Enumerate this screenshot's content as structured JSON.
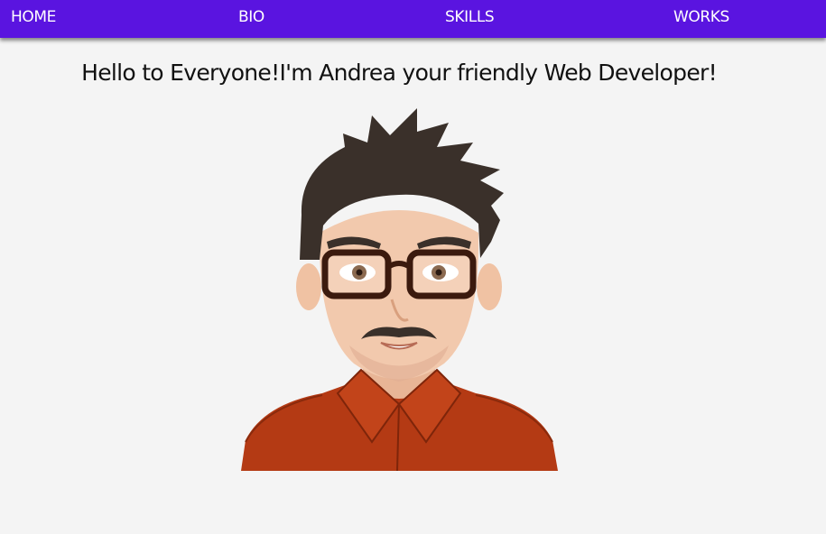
{
  "nav": {
    "items": [
      {
        "id": "home",
        "label": "HOME"
      },
      {
        "id": "bio",
        "label": "BIO"
      },
      {
        "id": "skills",
        "label": "SKILLS"
      },
      {
        "id": "works",
        "label": "WORKS"
      }
    ],
    "background": "#5a14e0",
    "text_color": "#ffffff"
  },
  "hero": {
    "greeting": "Hello to Everyone!I'm Andrea your friendly Web Developer!"
  },
  "avatar": {
    "icon": "cartoon-avatar-man-glasses-mustache",
    "colors": {
      "hair": "#3a302a",
      "skin": "#f2c9ad",
      "shirt": "#b43a14",
      "glasses": "#3b1a0e"
    }
  },
  "page": {
    "background": "#f4f4f4"
  }
}
